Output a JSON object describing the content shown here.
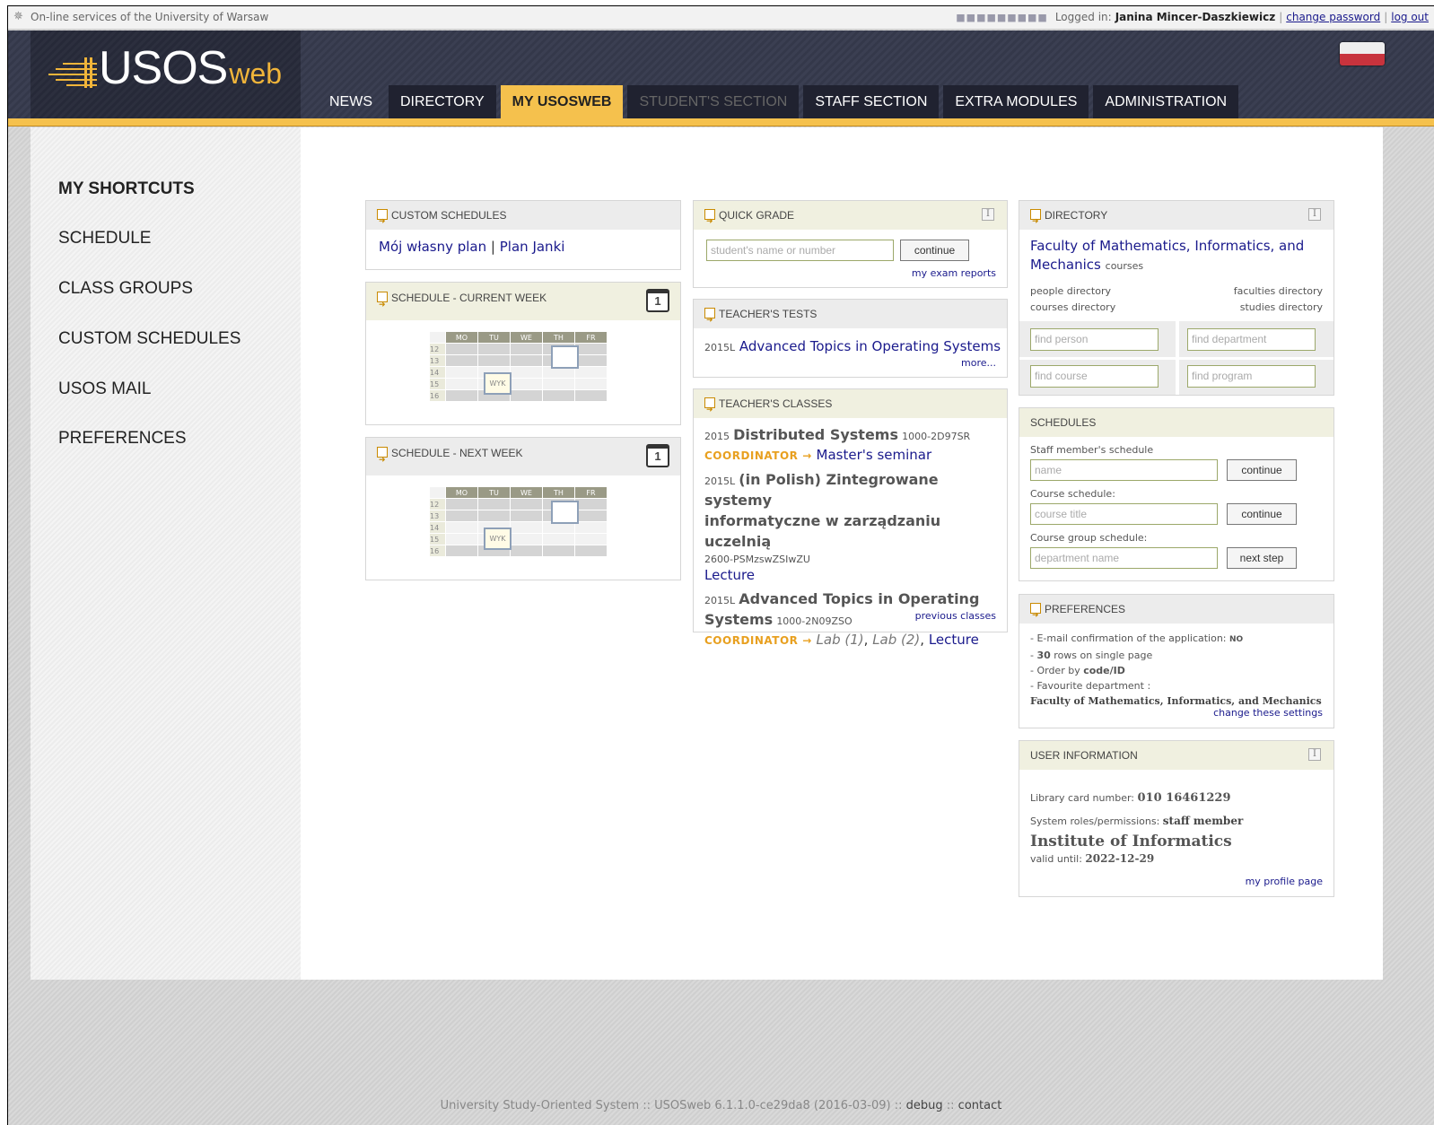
{
  "topbar": {
    "site_label": "On-line services of the University of Warsaw",
    "logged_in_label": "Logged in:",
    "user_name": "Janina Mincer-Daszkiewicz",
    "change_password": "change password",
    "logout": "log out"
  },
  "logo": {
    "main": "USOS",
    "suffix": "web"
  },
  "tabs": [
    {
      "label": "NEWS"
    },
    {
      "label": "DIRECTORY"
    },
    {
      "label": "MY USOSWEB"
    },
    {
      "label": "STUDENT'S SECTION"
    },
    {
      "label": "STAFF SECTION"
    },
    {
      "label": "EXTRA MODULES"
    },
    {
      "label": "ADMINISTRATION"
    }
  ],
  "sidebar": {
    "heading": "MY SHORTCUTS",
    "items": [
      "SCHEDULE",
      "CLASS GROUPS",
      "CUSTOM SCHEDULES",
      "USOS MAIL",
      "PREFERENCES"
    ]
  },
  "custom_schedules": {
    "title": "CUSTOM SCHEDULES",
    "link1": "Mój własny plan",
    "separator": "|",
    "link2": "Plan Janki"
  },
  "schedule_current": {
    "title": "SCHEDULE - CURRENT WEEK",
    "cal_day": "1",
    "days": [
      "MO",
      "TU",
      "WE",
      "TH",
      "FR"
    ],
    "hours": [
      "12",
      "13",
      "14",
      "15",
      "16"
    ],
    "event_label": "WYK"
  },
  "schedule_next": {
    "title": "SCHEDULE - NEXT WEEK",
    "cal_day": "1",
    "days": [
      "MO",
      "TU",
      "WE",
      "TH",
      "FR"
    ],
    "hours": [
      "12",
      "13",
      "14",
      "15",
      "16"
    ],
    "event_label": "WYK"
  },
  "quick_grade": {
    "title": "QUICK GRADE",
    "placeholder": "student's name or number",
    "button": "continue",
    "link": "my exam reports"
  },
  "teachers_tests": {
    "title": "TEACHER'S TESTS",
    "term": "2015L",
    "test": "Advanced Topics in Operating Systems",
    "more": "more..."
  },
  "teachers_classes": {
    "title": "TEACHER'S CLASSES",
    "c1_term": "2015",
    "c1_name": "Distributed Systems",
    "c1_code": "1000-2D97SR",
    "c1_role": "COORDINATOR",
    "arrow": "→",
    "c1_link": "Master's seminar",
    "c2_term": "2015L",
    "c2_name_a": "(in Polish) Zintegrowane systemy",
    "c2_name_b": "informatyczne w zarządzaniu uczelnią",
    "c2_code": "2600-PSMzswZSIwZU",
    "c2_link": "Lecture",
    "c3_term": "2015L",
    "c3_name_a": "Advanced Topics in Operating",
    "c3_name_b": "Systems",
    "c3_code": "1000-2N09ZSO",
    "c3_role": "COORDINATOR",
    "c3_lab1": "Lab (1)",
    "comma": ",",
    "c3_lab2": "Lab (2)",
    "c3_lecture": "Lecture",
    "previous": "previous classes"
  },
  "directory": {
    "title": "DIRECTORY",
    "faculty_a": "Faculty of Mathematics, Informatics, and",
    "faculty_b": "Mechanics",
    "courses": "courses",
    "people_dir": "people directory",
    "faculties_dir": "faculties directory",
    "courses_dir": "courses directory",
    "studies_dir": "studies directory",
    "find_person": "find person",
    "find_department": "find department",
    "find_course": "find course",
    "find_program": "find program"
  },
  "schedules": {
    "title": "SCHEDULES",
    "staff_label": "Staff member's schedule",
    "staff_placeholder": "name",
    "course_label": "Course schedule:",
    "course_placeholder": "course title",
    "group_label": "Course group schedule:",
    "group_placeholder": "department name",
    "continue": "continue",
    "next_step": "next step"
  },
  "preferences": {
    "title": "PREFERENCES",
    "email_label": "- E-mail confirmation of the application:",
    "email_value": "NO",
    "rows_prefix": "-",
    "rows_value": "30",
    "rows_label": "rows on single page",
    "order_label": "- Order by",
    "order_value": "code/ID",
    "fav_label": "- Favourite department :",
    "fav_value": "Faculty of Mathematics, Informatics, and Mechanics",
    "change": "change these settings"
  },
  "user_info": {
    "title": "USER INFORMATION",
    "library_label": "Library card number:",
    "library_value": "010 16461229",
    "roles_label": "System roles/permissions:",
    "roles_value": "staff member",
    "institute": "Institute of Informatics",
    "valid_label": "valid until:",
    "valid_value": "2022-12-29",
    "profile_link": "my profile page"
  },
  "footer": {
    "text": "University Study-Oriented System :: USOSweb 6.1.1.0-ce29da8 (2016-03-09) ::",
    "debug": "debug",
    "sep": "::",
    "contact": "contact"
  },
  "colors": {
    "accent": "#f5c14d",
    "header": "#3b3f52",
    "link": "#1a1a8c",
    "coordinator": "#e8a020"
  }
}
